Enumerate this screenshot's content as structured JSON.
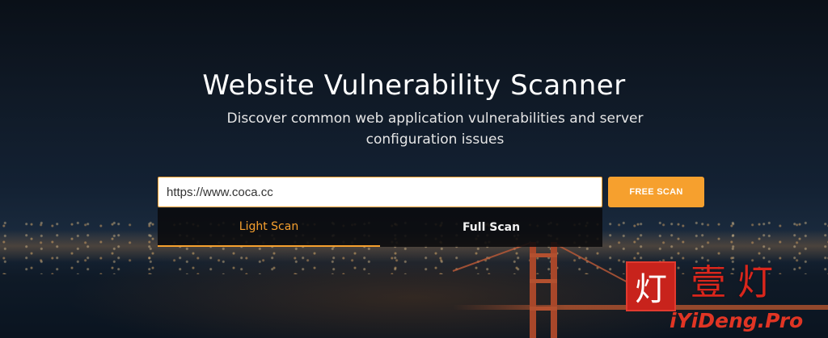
{
  "hero": {
    "title": "Website Vulnerability Scanner",
    "subtitle": "Discover common web application vulnerabilities and server configuration issues"
  },
  "scan": {
    "url_value": "https://www.coca.cc",
    "button_label": "FREE SCAN"
  },
  "tabs": [
    {
      "label": "Light Scan",
      "selected": true
    },
    {
      "label": "Full Scan",
      "selected": false
    }
  ],
  "watermark": {
    "seal_char": "灯",
    "chars": "壹灯",
    "domain": "iYiDeng.Pro"
  },
  "colors": {
    "accent": "#f6a02e",
    "watermark_red": "#d9261c"
  }
}
